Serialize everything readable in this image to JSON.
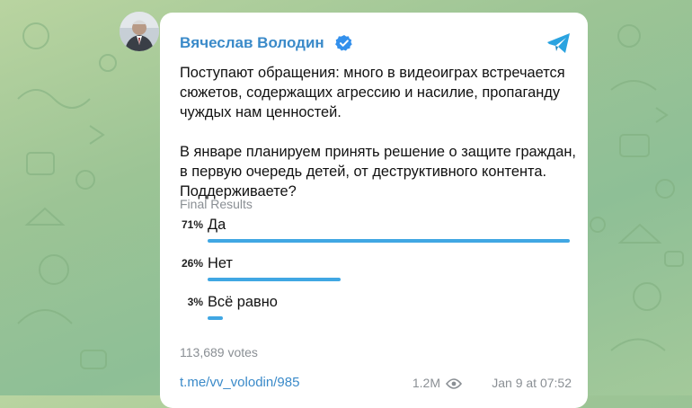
{
  "post": {
    "author": "Вячеслав Володин",
    "paragraphs": [
      "Поступают обращения: много в видеоиграх встречается сюжетов, содержащих агрессию и насилие, пропаганду чуждых нам ценностей.",
      "В январе планируем принять решение о защите граждан, в первую очередь детей, от деструктивного контента. Поддерживаете?"
    ]
  },
  "poll": {
    "status": "Final Results",
    "options": [
      {
        "percent_label": "71%",
        "label": "Да",
        "fraction": 0.71
      },
      {
        "percent_label": "26%",
        "label": "Нет",
        "fraction": 0.26
      },
      {
        "percent_label": "3%",
        "label": "Всё равно",
        "fraction": 0.03
      }
    ],
    "votes": "113,689 votes"
  },
  "footer": {
    "link": "t.me/vv_volodin/985",
    "views": "1.2M",
    "date": "Jan 9 at 07:52"
  },
  "colors": {
    "accent": "#3a8ac9",
    "bar": "#40a7e3",
    "verified": "#3390ec",
    "telegram": "#2aa3e0"
  },
  "icons": {
    "verified": "verified-badge-icon",
    "telegram": "telegram-plane-icon",
    "views": "eye-icon"
  }
}
